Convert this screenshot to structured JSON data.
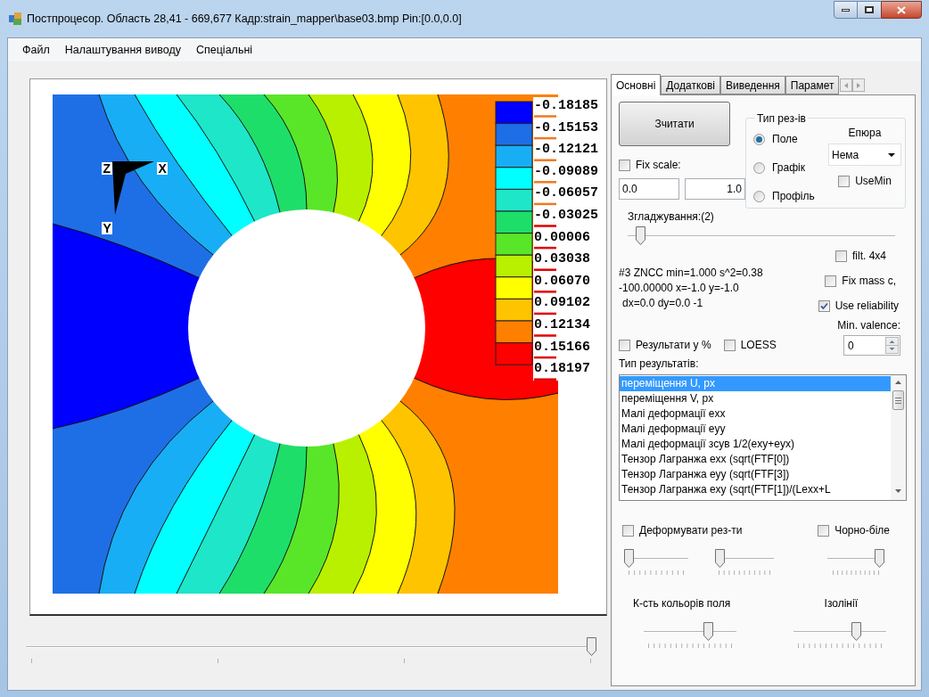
{
  "window": {
    "title": "Постпроцесор. Область 28,41 - 669,677 Кадр:strain_mapper\\base03.bmp Pin:[0.0,0.0]"
  },
  "menu": [
    "Файл",
    "Налаштування виводу",
    "Спеціальні"
  ],
  "plot": {
    "axes": [
      "Z",
      "X",
      "Y"
    ],
    "legend": [
      "-0.18185",
      "-0.15153",
      "-0.12121",
      "-0.09089",
      "-0.06057",
      "-0.03025",
      "0.00006",
      "0.03038",
      "0.06070",
      "0.09102",
      "0.12134",
      "0.15166",
      "0.18197"
    ]
  },
  "frame_slider": {
    "level": 1
  },
  "tabs": [
    {
      "label": "Основні",
      "selected": true
    },
    {
      "label": "Додаткові",
      "selected": false
    },
    {
      "label": "Виведення",
      "selected": false
    },
    {
      "label": "Парамет",
      "selected": false
    }
  ],
  "read_button": "Зчитати",
  "fix_scale": {
    "label": "Fix scale:",
    "checked": false
  },
  "scale_min": "0.0",
  "scale_max": "1.0",
  "result_kind": {
    "title": "Тип рез-ів",
    "options": [
      {
        "label": "Поле",
        "selected": true
      },
      {
        "label": "Графік",
        "selected": false
      },
      {
        "label": "Профіль",
        "selected": false
      }
    ]
  },
  "epure": {
    "label": "Епюра",
    "value": "Нема"
  },
  "use_min": {
    "label": "UseMin",
    "checked": false
  },
  "smoothing": {
    "label": "Згладжування:(2)",
    "level": 0.03
  },
  "info_lines": [
    "#3 ZNCC min=1.000 s^2=0.38",
    "-100.00000 x=-1.0 y=-1.0",
    "dx=0.0 dy=0.0 -1"
  ],
  "side_checks": [
    {
      "label": "filt. 4x4",
      "checked": false
    },
    {
      "label": "Fix mass c,",
      "checked": false
    },
    {
      "label": "Use reliability",
      "checked": true
    }
  ],
  "min_valence": {
    "label": "Min. valence:",
    "value": "0"
  },
  "percent": {
    "label": "Результати у %",
    "checked": false
  },
  "loess": {
    "label": "LOESS",
    "checked": false
  },
  "results_label": "Тип результатів:",
  "results": [
    {
      "label": "переміщення U, px",
      "selected": true
    },
    {
      "label": "переміщення V, px",
      "selected": false
    },
    {
      "label": "Малі деформації exx",
      "selected": false
    },
    {
      "label": "Малі деформації eyy",
      "selected": false
    },
    {
      "label": "Малі деформації зсув 1/2(exy+eyx)",
      "selected": false
    },
    {
      "label": "Тензор Лагранжа exx (sqrt(FTF[0])",
      "selected": false
    },
    {
      "label": "Тензор Лагранжа eyy (sqrt(FTF[3])",
      "selected": false
    },
    {
      "label": "Тензор Лагранжа exy (sqrt(FTF[1])/(Lexx+L",
      "selected": false
    }
  ],
  "deform": {
    "label": "Деформувати рез-ти",
    "checked": false
  },
  "black_white": {
    "label": "Чорно-біле",
    "checked": false
  },
  "small_sliders": [
    {
      "level": 0
    },
    {
      "level": 0
    },
    {
      "level": 1
    }
  ],
  "colors_count": {
    "label": "К-сть кольорів поля",
    "level": 0.72
  },
  "isolines": {
    "label": "Ізолінії",
    "level": 0.7
  }
}
